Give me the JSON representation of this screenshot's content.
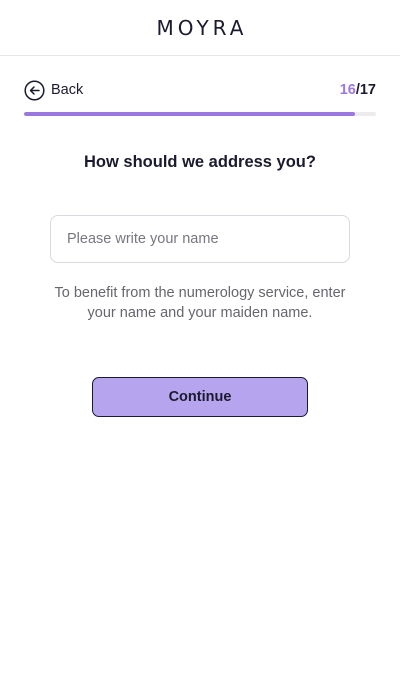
{
  "header": {
    "logo_text": "MOYRA"
  },
  "nav": {
    "back_label": "Back",
    "step_current": "16",
    "step_total": "/17"
  },
  "progress": {
    "fraction": 0.941,
    "color": "#9a78e0"
  },
  "form": {
    "question": "How should we address you?",
    "name_placeholder": "Please write your name",
    "name_value": "",
    "helper_text": "To benefit from the numerology service, enter your name and your maiden name.",
    "continue_label": "Continue"
  },
  "icons": {
    "back": "arrow-left-circle-icon"
  },
  "colors": {
    "accent": "#9b78e3",
    "button_bg": "#b6a5ee",
    "text": "#1b1b2f"
  }
}
